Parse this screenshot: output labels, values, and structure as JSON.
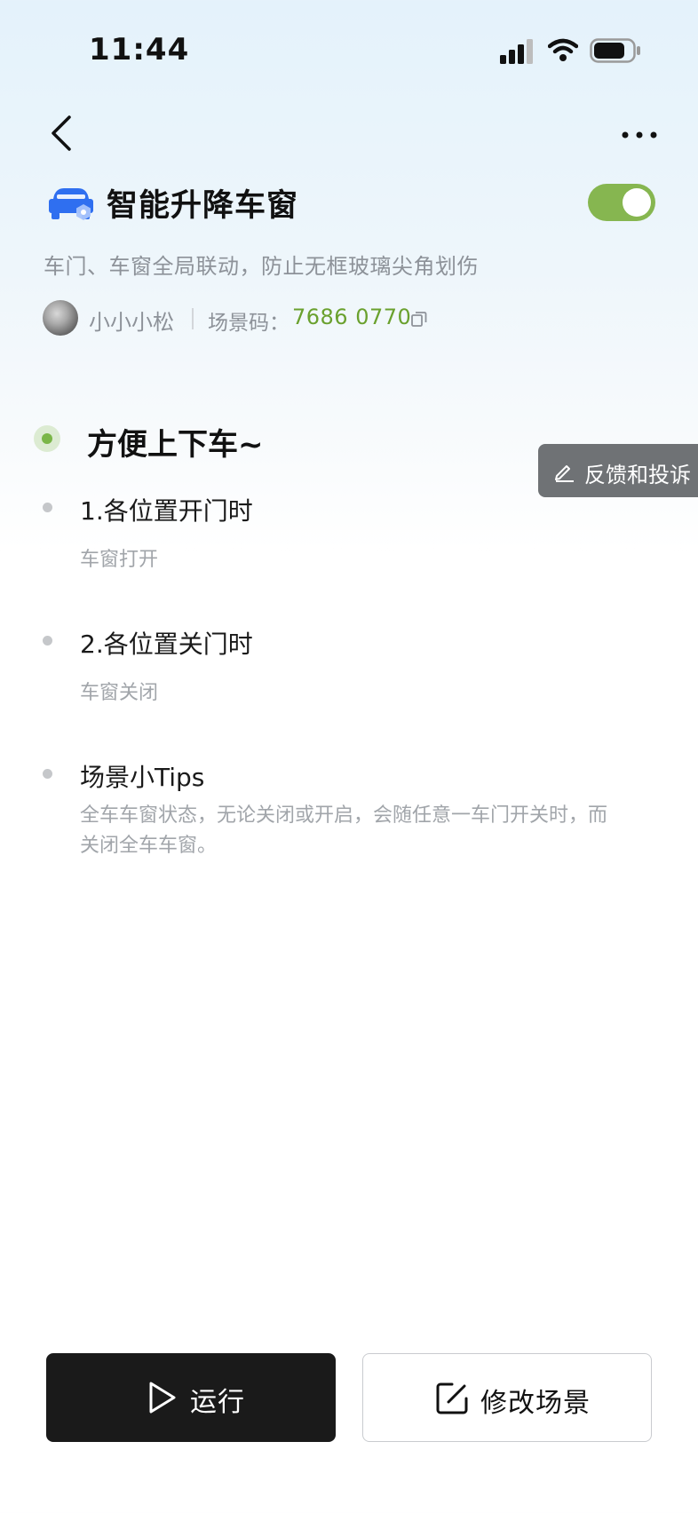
{
  "status_bar": {
    "time": "11:44"
  },
  "header": {
    "title": "智能升降车窗",
    "description": "车门、车窗全局联动，防止无框玻璃尖角划伤",
    "toggle_on": true,
    "author": "小小小松",
    "scene_code_label": "场景码：",
    "scene_code": "7686 0770"
  },
  "section": {
    "title": "方便上下车~",
    "items": [
      {
        "title": "1.各位置开门时",
        "desc": "车窗打开"
      },
      {
        "title": "2.各位置关门时",
        "desc": "车窗关闭"
      },
      {
        "title": "场景小Tips",
        "desc_line1": "全车车窗状态，无论关闭或开启，会随任意一车门开关时，而",
        "desc_line2": "关闭全车车窗。"
      }
    ]
  },
  "feedback": {
    "label": "反馈和投诉"
  },
  "footer": {
    "run_label": "运行",
    "edit_label": "修改场景"
  },
  "colors": {
    "accent_green": "#6aa12e",
    "toggle_green": "#86b650",
    "dark": "#1a1a1a"
  },
  "icons": [
    "back-icon",
    "more-icon",
    "car-icon",
    "copy-icon",
    "edit-icon",
    "play-icon",
    "signal-icon",
    "wifi-icon",
    "battery-icon"
  ]
}
